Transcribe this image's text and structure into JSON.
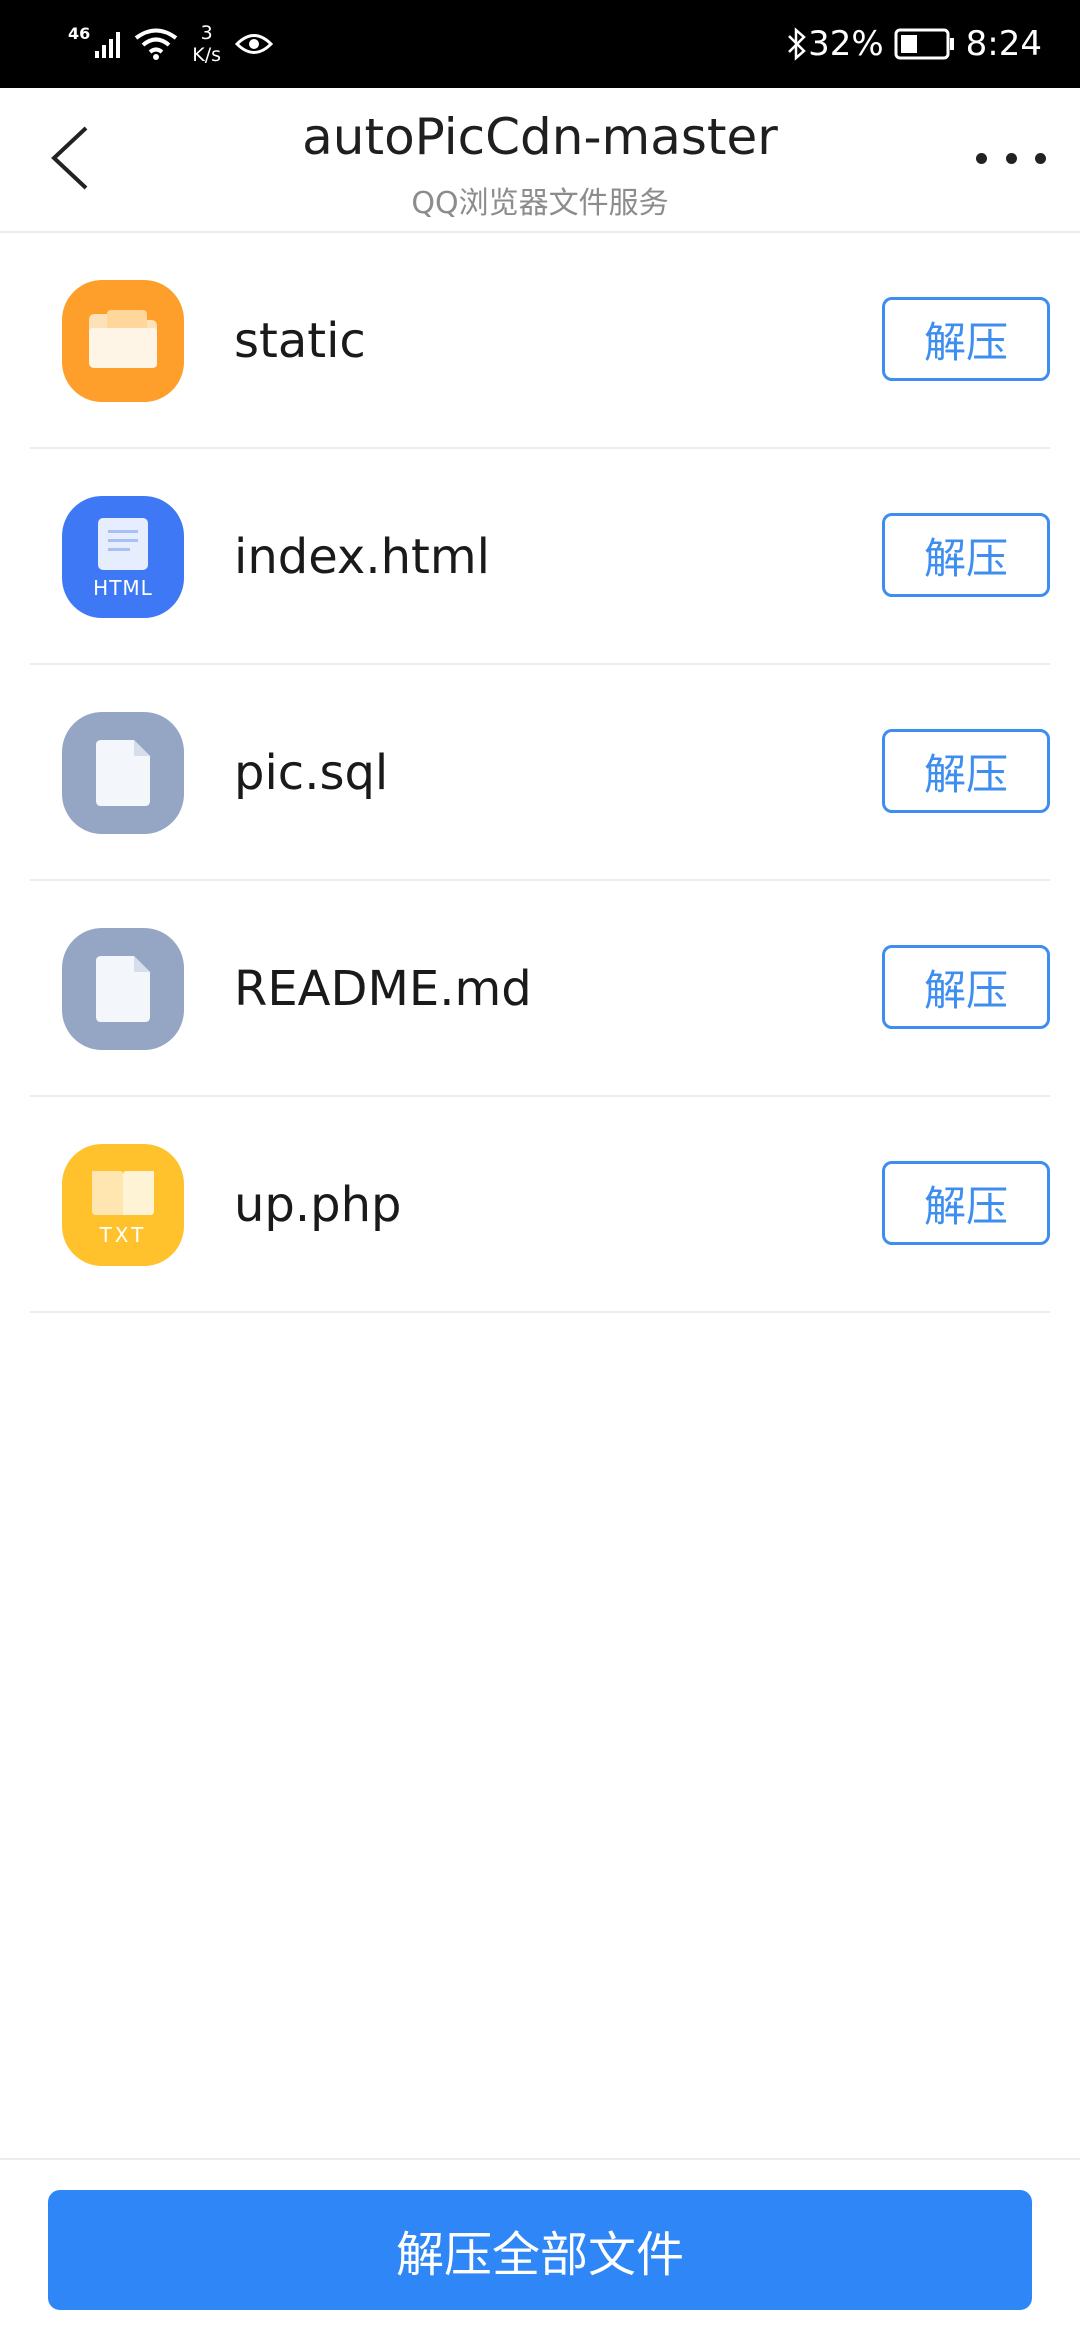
{
  "status_bar": {
    "network": "46",
    "speed_value": "3",
    "speed_unit": "K/s",
    "battery": "32%",
    "time": "8:24"
  },
  "header": {
    "title": "autoPicCdn-master",
    "subtitle": "QQ浏览器文件服务"
  },
  "files": [
    {
      "name": "static",
      "icon": "folder-icon",
      "action": "解压",
      "icon_color": "#fd9f2a"
    },
    {
      "name": "index.html",
      "icon": "html-file-icon",
      "icon_label": "HTML",
      "action": "解压",
      "icon_color": "#3f78f5"
    },
    {
      "name": "pic.sql",
      "icon": "file-icon",
      "action": "解压",
      "icon_color": "#94a6c3"
    },
    {
      "name": "README.md",
      "icon": "file-icon",
      "action": "解压",
      "icon_color": "#94a6c3"
    },
    {
      "name": "up.php",
      "icon": "txt-file-icon",
      "icon_label": "TXT",
      "action": "解压",
      "icon_color": "#ffc12c"
    }
  ],
  "footer": {
    "extract_all_label": "解压全部文件"
  },
  "colors": {
    "accent": "#2e86f7",
    "button_outline": "#3d8ef0"
  }
}
